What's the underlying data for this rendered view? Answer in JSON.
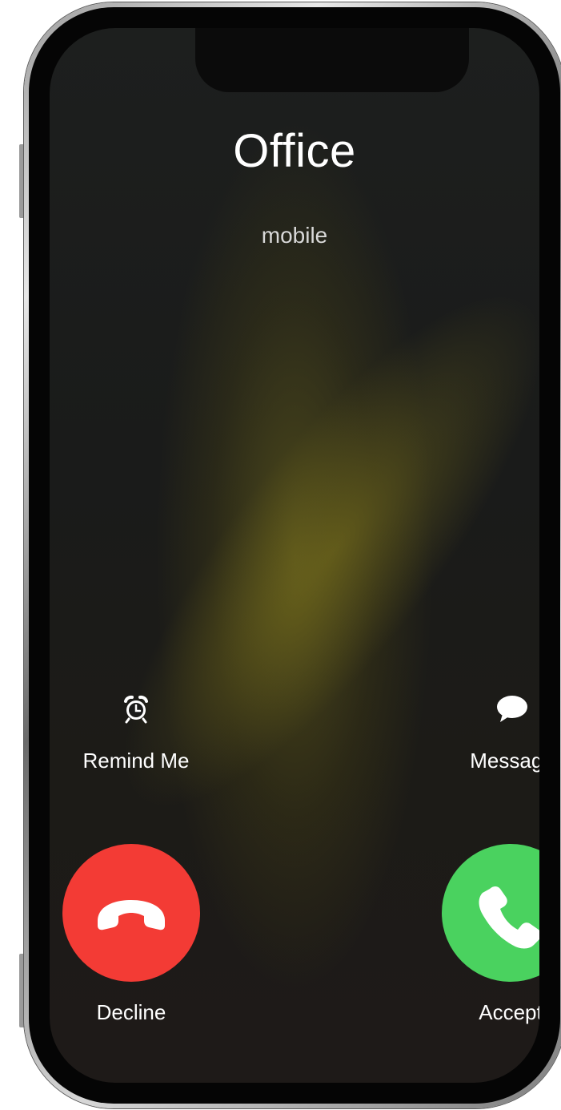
{
  "call": {
    "caller_name": "Office",
    "caller_label": "mobile"
  },
  "actions": {
    "remind_label": "Remind Me",
    "remind_icon": "alarm-clock-icon",
    "message_label": "Message",
    "message_icon": "speech-bubble-icon"
  },
  "buttons": {
    "decline_label": "Decline",
    "decline_icon": "phone-hang-up-icon",
    "decline_color": "#f33b35",
    "accept_label": "Accept",
    "accept_icon": "phone-icon",
    "accept_color": "#4ad25f"
  }
}
